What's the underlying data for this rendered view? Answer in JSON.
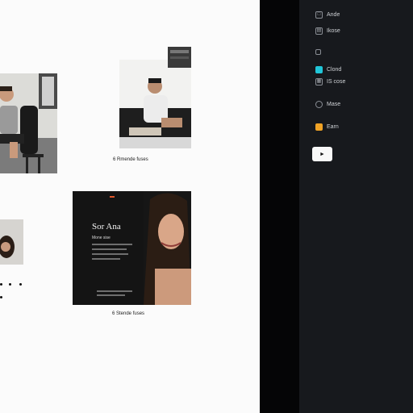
{
  "canvas": {
    "caption_1": "6  Rmende  fuses",
    "caption_2": "6  Stende  fuses"
  },
  "promo": {
    "title": "Sor Ana",
    "subtitle": "Mone sise"
  },
  "sidebar": {
    "items": [
      {
        "label": "Ande",
        "icon": "image-icon"
      },
      {
        "label": "Ikose",
        "icon": "layers-icon"
      },
      {
        "label": "",
        "icon": "square-icon"
      },
      {
        "label": "Clond",
        "icon": "cloud-icon"
      },
      {
        "label": "IS cose",
        "icon": "grid-icon"
      },
      {
        "label": "Mase",
        "icon": "settings-icon"
      },
      {
        "label": "Earn",
        "icon": "coin-icon"
      }
    ],
    "play_label": "►"
  },
  "colors": {
    "canvas_bg": "#fbfbfb",
    "sidebar_bg": "#17191d",
    "divider": "#050506",
    "accent_cyan": "#21c6d8",
    "accent_orange": "#f0a326",
    "promo_accent": "#e0572b"
  }
}
